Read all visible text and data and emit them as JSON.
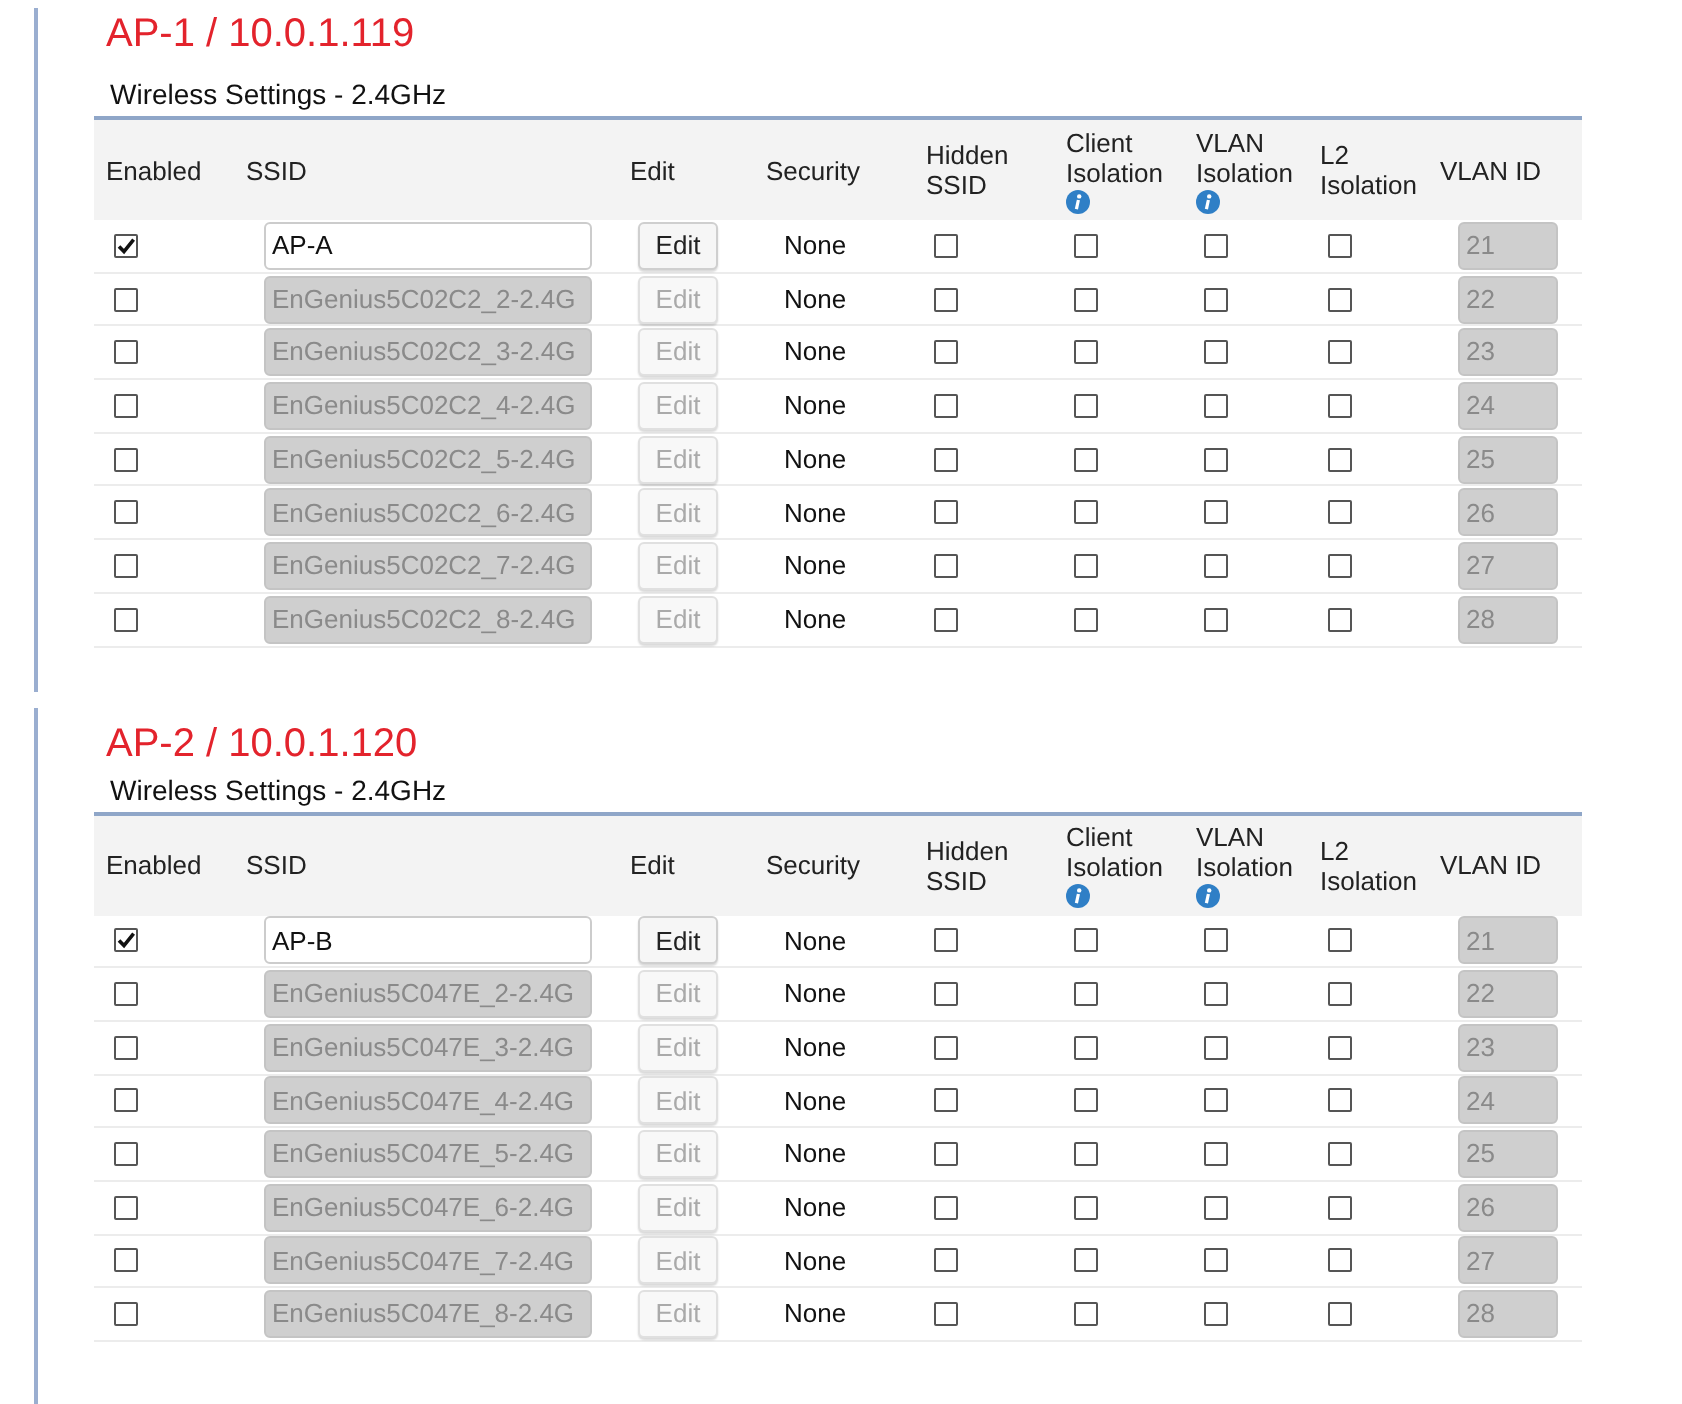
{
  "sections": [
    {
      "title": "AP-1 / 10.0.1.119",
      "subtitle": "Wireless Settings - 2.4GHz",
      "columns": [
        {
          "label": "Enabled",
          "info": false
        },
        {
          "label": "SSID",
          "info": false
        },
        {
          "label": "Edit",
          "info": false
        },
        {
          "label": "Security",
          "info": false
        },
        {
          "label": "Hidden SSID",
          "info": false
        },
        {
          "label": "Client Isolation",
          "info": true
        },
        {
          "label": "VLAN Isolation",
          "info": true
        },
        {
          "label": "L2 Isolation",
          "info": false
        },
        {
          "label": "VLAN ID",
          "info": false
        }
      ],
      "rows": [
        {
          "enabled": true,
          "ssid": "AP-A",
          "edit": "Edit",
          "security": "None",
          "hidden_ssid": false,
          "client_isolation": false,
          "vlan_isolation": false,
          "l2_isolation": false,
          "vlan_id": "21"
        },
        {
          "enabled": false,
          "ssid": "EnGenius5C02C2_2-2.4G",
          "edit": "Edit",
          "security": "None",
          "hidden_ssid": false,
          "client_isolation": false,
          "vlan_isolation": false,
          "l2_isolation": false,
          "vlan_id": "22"
        },
        {
          "enabled": false,
          "ssid": "EnGenius5C02C2_3-2.4G",
          "edit": "Edit",
          "security": "None",
          "hidden_ssid": false,
          "client_isolation": false,
          "vlan_isolation": false,
          "l2_isolation": false,
          "vlan_id": "23"
        },
        {
          "enabled": false,
          "ssid": "EnGenius5C02C2_4-2.4G",
          "edit": "Edit",
          "security": "None",
          "hidden_ssid": false,
          "client_isolation": false,
          "vlan_isolation": false,
          "l2_isolation": false,
          "vlan_id": "24"
        },
        {
          "enabled": false,
          "ssid": "EnGenius5C02C2_5-2.4G",
          "edit": "Edit",
          "security": "None",
          "hidden_ssid": false,
          "client_isolation": false,
          "vlan_isolation": false,
          "l2_isolation": false,
          "vlan_id": "25"
        },
        {
          "enabled": false,
          "ssid": "EnGenius5C02C2_6-2.4G",
          "edit": "Edit",
          "security": "None",
          "hidden_ssid": false,
          "client_isolation": false,
          "vlan_isolation": false,
          "l2_isolation": false,
          "vlan_id": "26"
        },
        {
          "enabled": false,
          "ssid": "EnGenius5C02C2_7-2.4G",
          "edit": "Edit",
          "security": "None",
          "hidden_ssid": false,
          "client_isolation": false,
          "vlan_isolation": false,
          "l2_isolation": false,
          "vlan_id": "27"
        },
        {
          "enabled": false,
          "ssid": "EnGenius5C02C2_8-2.4G",
          "edit": "Edit",
          "security": "None",
          "hidden_ssid": false,
          "client_isolation": false,
          "vlan_isolation": false,
          "l2_isolation": false,
          "vlan_id": "28"
        }
      ]
    },
    {
      "title": "AP-2 / 10.0.1.120",
      "subtitle": "Wireless Settings - 2.4GHz",
      "columns": [
        {
          "label": "Enabled",
          "info": false
        },
        {
          "label": "SSID",
          "info": false
        },
        {
          "label": "Edit",
          "info": false
        },
        {
          "label": "Security",
          "info": false
        },
        {
          "label": "Hidden SSID",
          "info": false
        },
        {
          "label": "Client Isolation",
          "info": true
        },
        {
          "label": "VLAN Isolation",
          "info": true
        },
        {
          "label": "L2 Isolation",
          "info": false
        },
        {
          "label": "VLAN ID",
          "info": false
        }
      ],
      "rows": [
        {
          "enabled": true,
          "ssid": "AP-B",
          "edit": "Edit",
          "security": "None",
          "hidden_ssid": false,
          "client_isolation": false,
          "vlan_isolation": false,
          "l2_isolation": false,
          "vlan_id": "21"
        },
        {
          "enabled": false,
          "ssid": "EnGenius5C047E_2-2.4G",
          "edit": "Edit",
          "security": "None",
          "hidden_ssid": false,
          "client_isolation": false,
          "vlan_isolation": false,
          "l2_isolation": false,
          "vlan_id": "22"
        },
        {
          "enabled": false,
          "ssid": "EnGenius5C047E_3-2.4G",
          "edit": "Edit",
          "security": "None",
          "hidden_ssid": false,
          "client_isolation": false,
          "vlan_isolation": false,
          "l2_isolation": false,
          "vlan_id": "23"
        },
        {
          "enabled": false,
          "ssid": "EnGenius5C047E_4-2.4G",
          "edit": "Edit",
          "security": "None",
          "hidden_ssid": false,
          "client_isolation": false,
          "vlan_isolation": false,
          "l2_isolation": false,
          "vlan_id": "24"
        },
        {
          "enabled": false,
          "ssid": "EnGenius5C047E_5-2.4G",
          "edit": "Edit",
          "security": "None",
          "hidden_ssid": false,
          "client_isolation": false,
          "vlan_isolation": false,
          "l2_isolation": false,
          "vlan_id": "25"
        },
        {
          "enabled": false,
          "ssid": "EnGenius5C047E_6-2.4G",
          "edit": "Edit",
          "security": "None",
          "hidden_ssid": false,
          "client_isolation": false,
          "vlan_isolation": false,
          "l2_isolation": false,
          "vlan_id": "26"
        },
        {
          "enabled": false,
          "ssid": "EnGenius5C047E_7-2.4G",
          "edit": "Edit",
          "security": "None",
          "hidden_ssid": false,
          "client_isolation": false,
          "vlan_isolation": false,
          "l2_isolation": false,
          "vlan_id": "27"
        },
        {
          "enabled": false,
          "ssid": "EnGenius5C047E_8-2.4G",
          "edit": "Edit",
          "security": "None",
          "hidden_ssid": false,
          "client_isolation": false,
          "vlan_isolation": false,
          "l2_isolation": false,
          "vlan_id": "28"
        }
      ]
    }
  ]
}
